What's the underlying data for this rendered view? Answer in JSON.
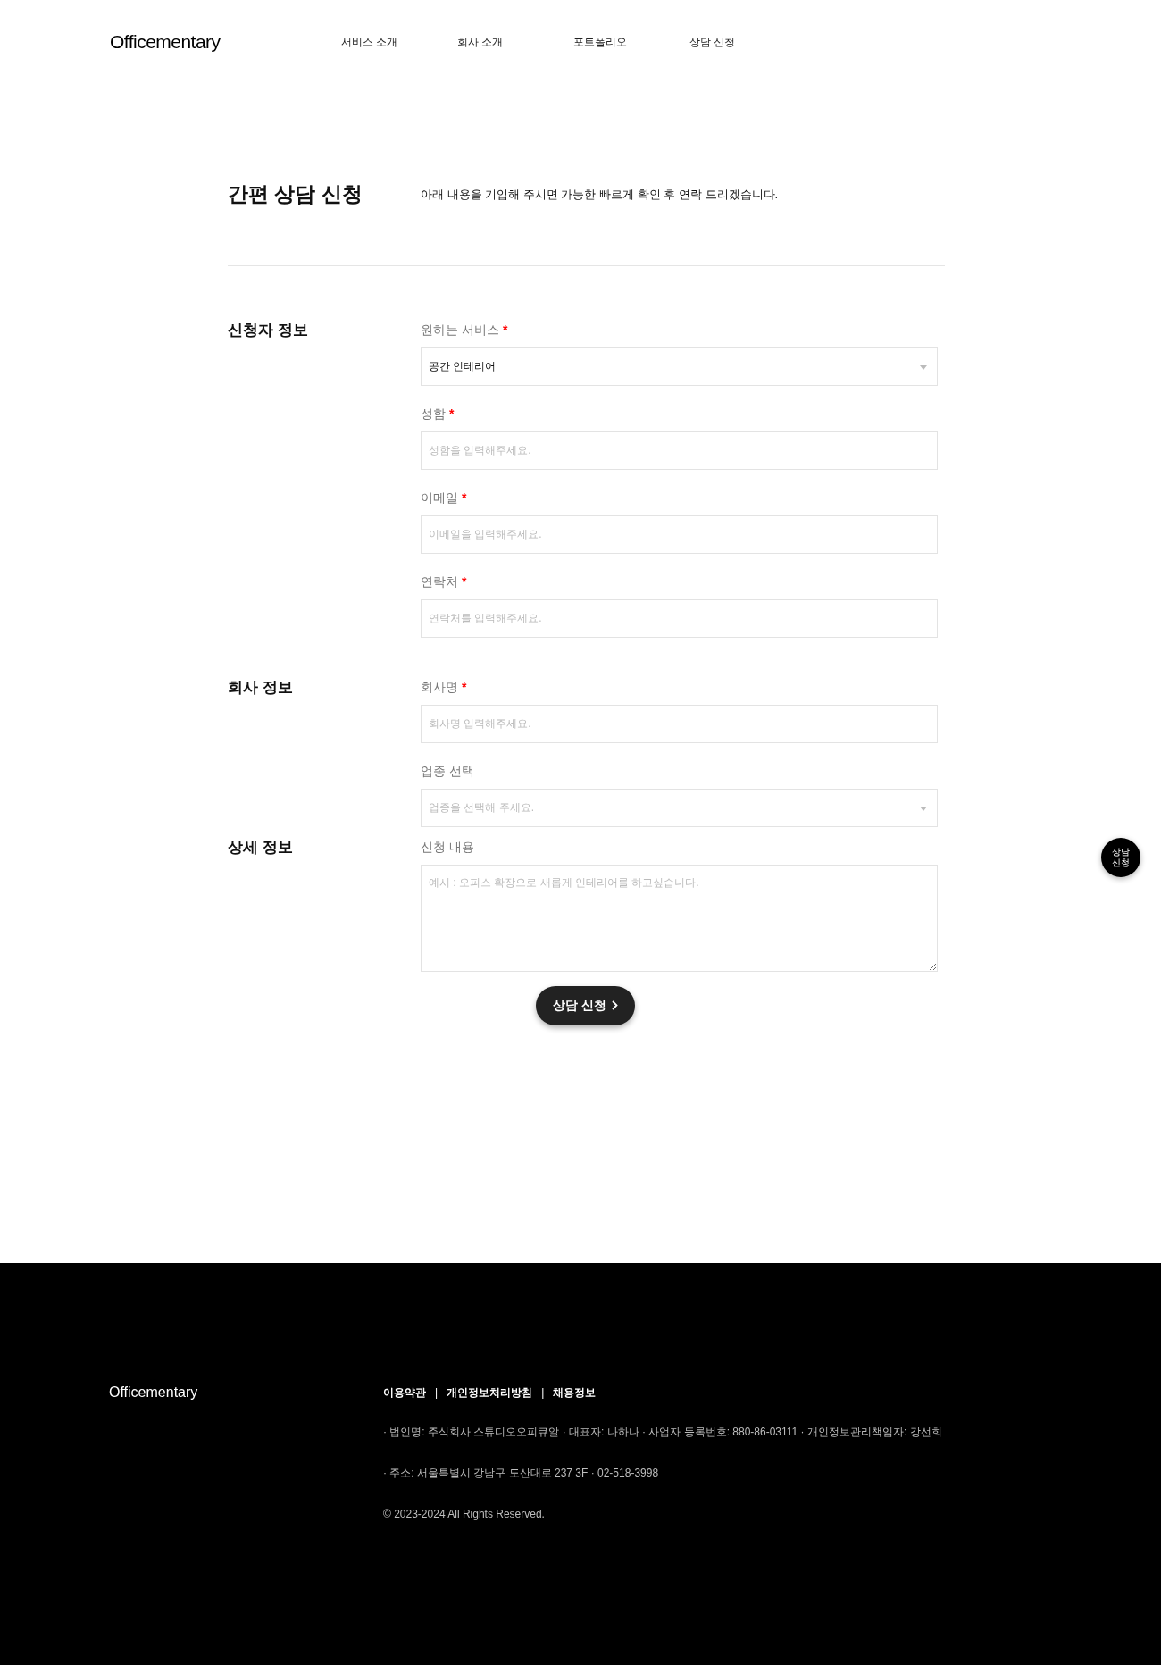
{
  "header": {
    "logo": "Officementary",
    "nav": [
      {
        "label": "서비스 소개"
      },
      {
        "label": "회사 소개"
      },
      {
        "label": "포트폴리오"
      },
      {
        "label": "상담 신청"
      }
    ]
  },
  "intro": {
    "title": "간편 상담 신청",
    "description": "아래 내용을 기입해 주시면 가능한 빠르게 확인 후 연락 드리겠습니다."
  },
  "required_mark": "*",
  "sections": [
    {
      "title": "신청자 정보",
      "fields": [
        {
          "kind": "select",
          "label": "원하는 서비스",
          "required": true,
          "value": "공간 인테리어"
        },
        {
          "kind": "input",
          "label": "성함",
          "required": true,
          "placeholder": "성함을 입력해주세요."
        },
        {
          "kind": "input",
          "label": "이메일",
          "required": true,
          "placeholder": "이메일을 입력해주세요."
        },
        {
          "kind": "input",
          "label": "연락처",
          "required": true,
          "placeholder": "연락처를 입력해주세요."
        }
      ]
    },
    {
      "title": "회사 정보",
      "fields": [
        {
          "kind": "input",
          "label": "회사명",
          "required": true,
          "placeholder": "회사명 입력해주세요."
        },
        {
          "kind": "select",
          "label": "업종 선택",
          "required": false,
          "placeholder": "업종을 선택해 주세요."
        }
      ]
    },
    {
      "title": "상세 정보",
      "fields": [
        {
          "kind": "textarea",
          "label": "신청 내용",
          "required": false,
          "placeholder": "예시 : 오피스 확장으로 새롭게 인테리어를 하고싶습니다."
        }
      ]
    }
  ],
  "submit_button": "상담 신청",
  "floating_button": {
    "line_1": "상담",
    "line_2": "신청"
  },
  "footer": {
    "logo": "Officementary",
    "separator": "|",
    "links": [
      {
        "label": "이용약관"
      },
      {
        "label": "개인정보처리방침"
      },
      {
        "label": "채용정보"
      }
    ],
    "info_lines": [
      "· 법인명: 주식회사 스튜디오오피큐알 · 대표자: 나하나 · 사업자 등록번호: 880-86-03111 · 개인정보관리책임자: 강선희",
      "· 주소: 서울특별시 강남구 도산대로 237 3F · 02-518-3998"
    ],
    "copyright": "© 2023-2024 All Rights Reserved."
  }
}
